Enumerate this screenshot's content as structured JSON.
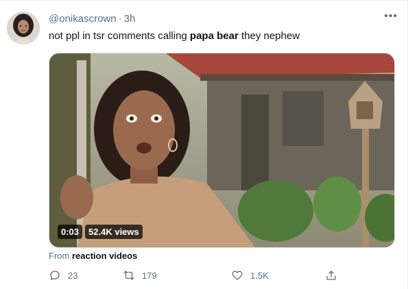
{
  "tweet": {
    "handle": "@onikascrown",
    "separator": "·",
    "time": "3h",
    "more_icon": "more-horizontal-icon",
    "text_parts": {
      "before": "not ppl in tsr comments calling ",
      "bold": "papa bear",
      "after": " they nephew"
    }
  },
  "video": {
    "duration": "0:03",
    "views": "52.4K views"
  },
  "source": {
    "prefix": "From ",
    "name": "reaction videos"
  },
  "actions": {
    "reply": {
      "icon": "reply-icon",
      "count": "23"
    },
    "retweet": {
      "icon": "retweet-icon",
      "count": "179"
    },
    "like": {
      "icon": "heart-icon",
      "count": "1.5K"
    },
    "share": {
      "icon": "share-icon"
    }
  },
  "colors": {
    "secondary_text": "#5b7083",
    "primary_text": "#0f1419",
    "border": "#ebeef0"
  }
}
